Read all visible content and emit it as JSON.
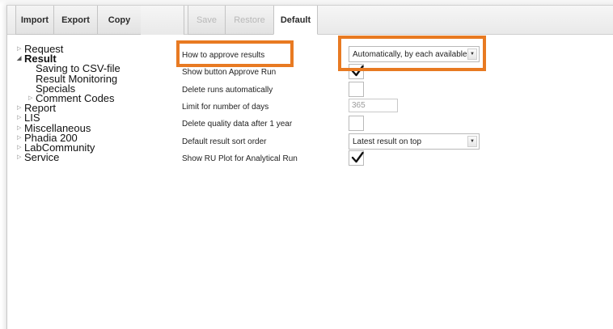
{
  "toolbar": {
    "import_label": "Import",
    "export_label": "Export",
    "copy_label": "Copy",
    "save_label": "Save",
    "restore_label": "Restore",
    "default_label": "Default"
  },
  "tree": {
    "items": [
      {
        "label": "Request"
      },
      {
        "label": "Result"
      },
      {
        "label": "Saving to CSV-file"
      },
      {
        "label": "Result Monitoring"
      },
      {
        "label": "Specials"
      },
      {
        "label": "Comment Codes"
      },
      {
        "label": "Report"
      },
      {
        "label": "LIS"
      },
      {
        "label": "Miscellaneous"
      },
      {
        "label": "Phadia 200"
      },
      {
        "label": "LabCommunity"
      },
      {
        "label": "Service"
      }
    ]
  },
  "settings": {
    "approve_results": {
      "label": "How to approve results",
      "value": "Automatically, by each available..."
    },
    "show_approve_run": {
      "label": "Show button Approve Run",
      "checked": true
    },
    "delete_runs": {
      "label": "Delete runs automatically",
      "checked": false
    },
    "limit_days": {
      "label": "Limit for number of days",
      "value": "365"
    },
    "delete_quality": {
      "label": "Delete quality data after 1 year",
      "checked": false
    },
    "sort_order": {
      "label": "Default result sort order",
      "value": "Latest result on top"
    },
    "show_ru_plot": {
      "label": "Show RU Plot for Analytical Run",
      "checked": true
    }
  },
  "colors": {
    "highlight": "#e87a22"
  }
}
